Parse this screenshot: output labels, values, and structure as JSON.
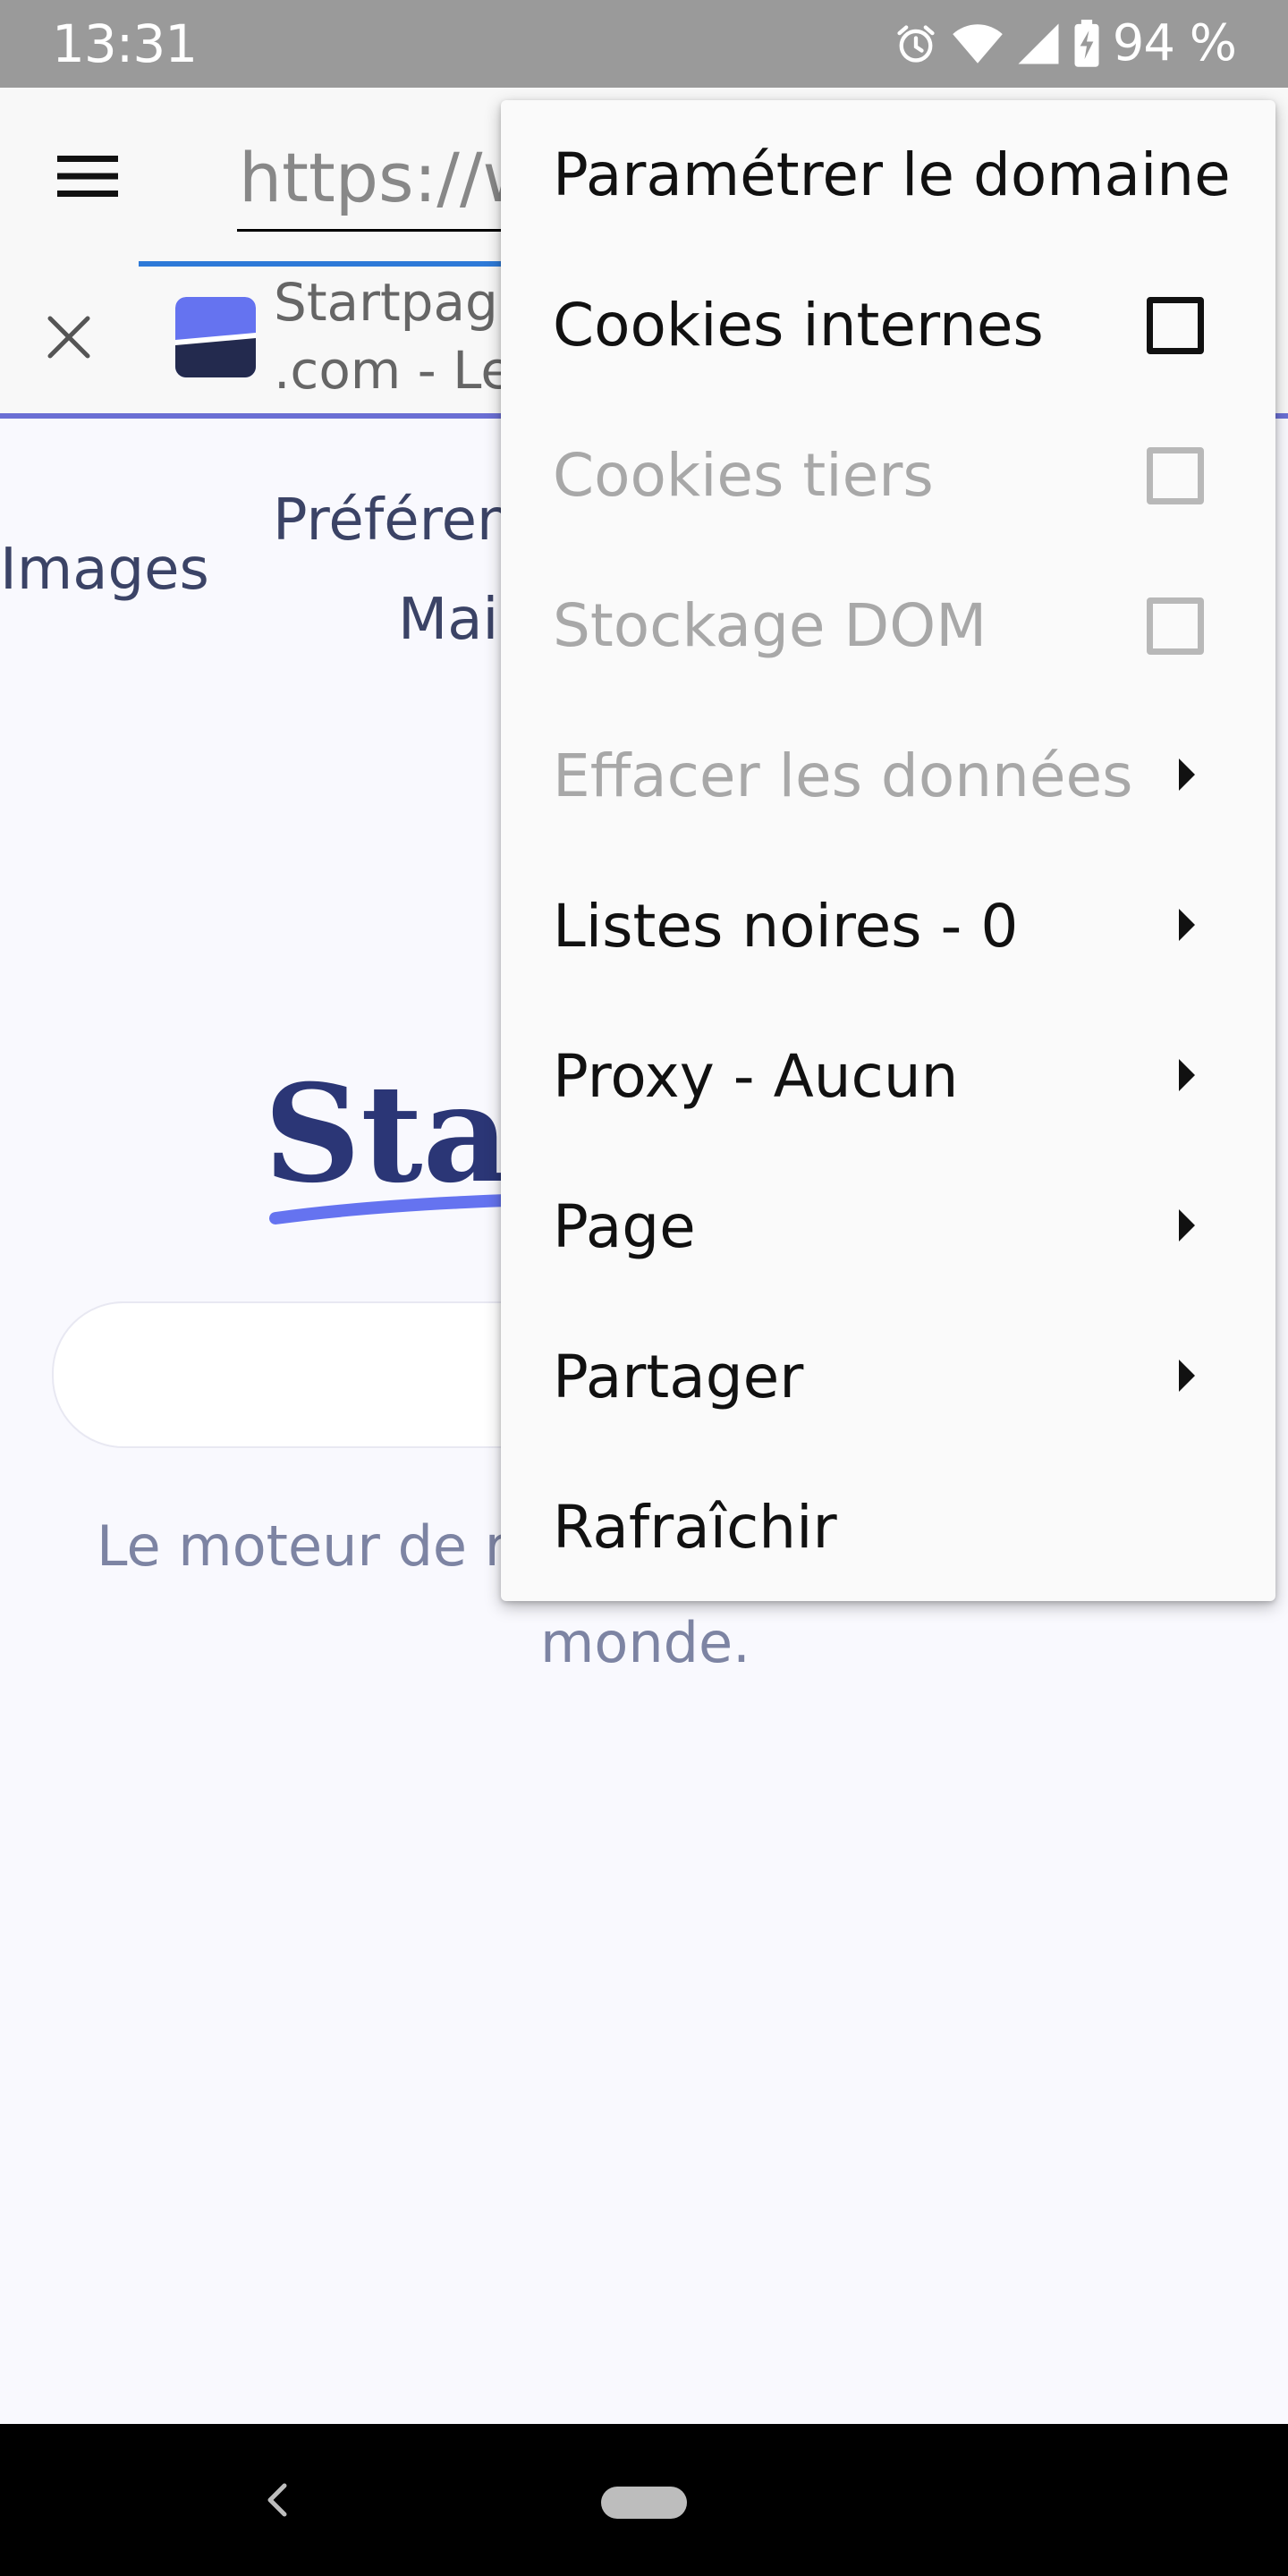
{
  "status_bar": {
    "time": "13:31",
    "battery_percent": "94 %",
    "icons": [
      "alarm-icon",
      "wifi-icon",
      "cell-signal-icon",
      "battery-charging-icon"
    ]
  },
  "app_bar": {
    "url": "https://www.startpage.com",
    "tab_title_line1": "Startpage",
    "tab_title_line2": ".com - Le",
    "accent_color": "#2e7ad8",
    "divider_color": "#6b6fd4"
  },
  "page": {
    "nav_images": "Images",
    "nav_preferences": "Préférences",
    "nav_mail": "Mail",
    "logo_text": "Startpage",
    "tagline_line1": "Le moteur de recherche le plus privé au",
    "tagline_line2": "monde.",
    "brand_color": "#2b3676",
    "logo_accent_color": "#6573f0"
  },
  "menu": {
    "items": [
      {
        "label": "Paramétrer le domaine",
        "disabled": false,
        "control": "none"
      },
      {
        "label": "Cookies internes",
        "disabled": false,
        "control": "checkbox",
        "checked": false
      },
      {
        "label": "Cookies tiers",
        "disabled": true,
        "control": "checkbox",
        "checked": false
      },
      {
        "label": "Stockage DOM",
        "disabled": true,
        "control": "checkbox",
        "checked": false
      },
      {
        "label": "Effacer les données",
        "disabled": true,
        "control": "submenu"
      },
      {
        "label": "Listes noires - 0",
        "disabled": false,
        "control": "submenu"
      },
      {
        "label": "Proxy - Aucun",
        "disabled": false,
        "control": "submenu"
      },
      {
        "label": "Page",
        "disabled": false,
        "control": "submenu"
      },
      {
        "label": "Partager",
        "disabled": false,
        "control": "submenu"
      },
      {
        "label": "Rafraîchir",
        "disabled": false,
        "control": "none"
      }
    ]
  },
  "nav_bar": {
    "icons": [
      "back-icon",
      "home-pill"
    ]
  }
}
